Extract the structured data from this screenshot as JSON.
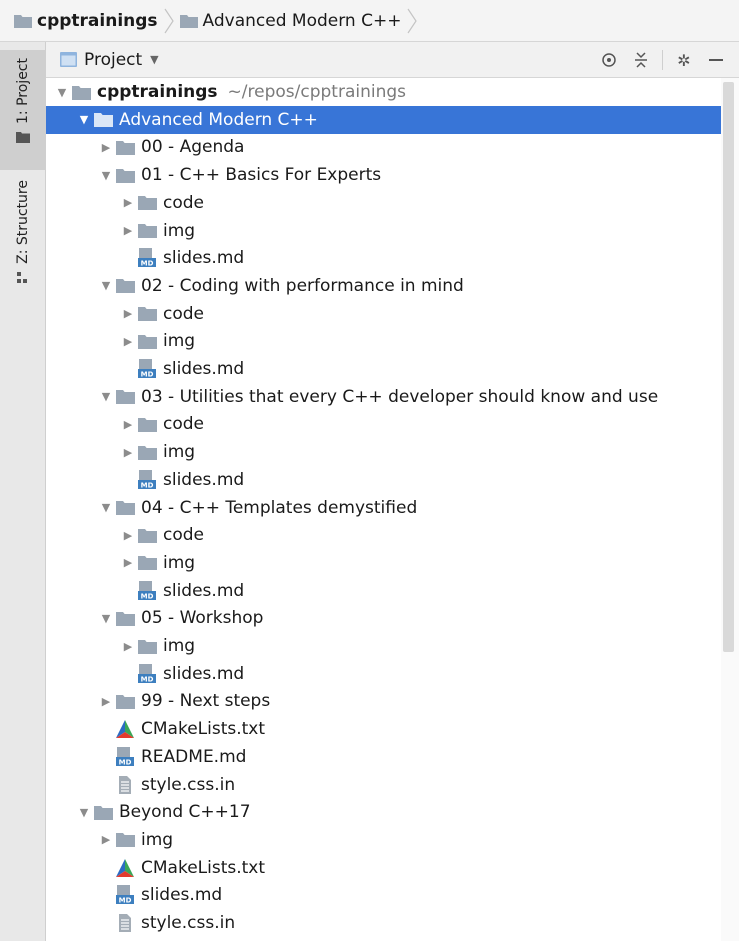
{
  "breadcrumb": [
    {
      "label": "cpptrainings",
      "bold": true
    },
    {
      "label": "Advanced Modern C++",
      "bold": false
    }
  ],
  "left_strip": {
    "tabs": [
      {
        "label": "1: Project",
        "active": true,
        "icon": "folder-icon"
      },
      {
        "label": "Z: Structure",
        "active": false,
        "icon": "structure-icon"
      }
    ]
  },
  "tool_window": {
    "title": "Project",
    "dropdown_icon": "chevron-down-icon",
    "actions": [
      "locate-icon",
      "collapse-all-icon",
      "settings-icon",
      "minimize-icon"
    ]
  },
  "tree": {
    "rows": [
      {
        "label": "cpptrainings",
        "hint": "~/repos/cpptrainings",
        "type": "folder",
        "expanded": true,
        "depth": 0,
        "selected": false
      },
      {
        "label": "Advanced Modern C++",
        "type": "folder",
        "expanded": true,
        "depth": 1,
        "selected": true
      },
      {
        "label": "00 - Agenda",
        "type": "folder",
        "expanded": false,
        "depth": 2
      },
      {
        "label": "01 - C++ Basics For Experts",
        "type": "folder",
        "expanded": true,
        "depth": 2
      },
      {
        "label": "code",
        "type": "folder",
        "expanded": false,
        "depth": 3
      },
      {
        "label": "img",
        "type": "folder",
        "expanded": false,
        "depth": 3
      },
      {
        "label": "slides.md",
        "type": "md",
        "depth": 3
      },
      {
        "label": "02 - Coding with performance in mind",
        "type": "folder",
        "expanded": true,
        "depth": 2
      },
      {
        "label": "code",
        "type": "folder",
        "expanded": false,
        "depth": 3
      },
      {
        "label": "img",
        "type": "folder",
        "expanded": false,
        "depth": 3
      },
      {
        "label": "slides.md",
        "type": "md",
        "depth": 3
      },
      {
        "label": "03 - Utilities that every C++ developer should know and use",
        "type": "folder",
        "expanded": true,
        "depth": 2
      },
      {
        "label": "code",
        "type": "folder",
        "expanded": false,
        "depth": 3
      },
      {
        "label": "img",
        "type": "folder",
        "expanded": false,
        "depth": 3
      },
      {
        "label": "slides.md",
        "type": "md",
        "depth": 3
      },
      {
        "label": "04 - C++ Templates demystified",
        "type": "folder",
        "expanded": true,
        "depth": 2
      },
      {
        "label": "code",
        "type": "folder",
        "expanded": false,
        "depth": 3
      },
      {
        "label": "img",
        "type": "folder",
        "expanded": false,
        "depth": 3
      },
      {
        "label": "slides.md",
        "type": "md",
        "depth": 3
      },
      {
        "label": "05 - Workshop",
        "type": "folder",
        "expanded": true,
        "depth": 2
      },
      {
        "label": "img",
        "type": "folder",
        "expanded": false,
        "depth": 3
      },
      {
        "label": "slides.md",
        "type": "md",
        "depth": 3
      },
      {
        "label": "99 - Next steps",
        "type": "folder",
        "expanded": false,
        "depth": 2
      },
      {
        "label": "CMakeLists.txt",
        "type": "cmake",
        "depth": 2
      },
      {
        "label": "README.md",
        "type": "md",
        "depth": 2
      },
      {
        "label": "style.css.in",
        "type": "text",
        "depth": 2
      },
      {
        "label": "Beyond C++17",
        "type": "folder",
        "expanded": true,
        "depth": 1
      },
      {
        "label": "img",
        "type": "folder",
        "expanded": false,
        "depth": 2
      },
      {
        "label": "CMakeLists.txt",
        "type": "cmake",
        "depth": 2
      },
      {
        "label": "slides.md",
        "type": "md",
        "depth": 2
      },
      {
        "label": "style.css.in",
        "type": "text",
        "depth": 2
      }
    ]
  },
  "colors": {
    "selection": "#3875d7",
    "folder": "#9aa7b5",
    "md_badge": "#3d7fbf",
    "cmake_red": "#e23b2e",
    "cmake_blue": "#2b6cc4",
    "cmake_green": "#3aa757"
  }
}
